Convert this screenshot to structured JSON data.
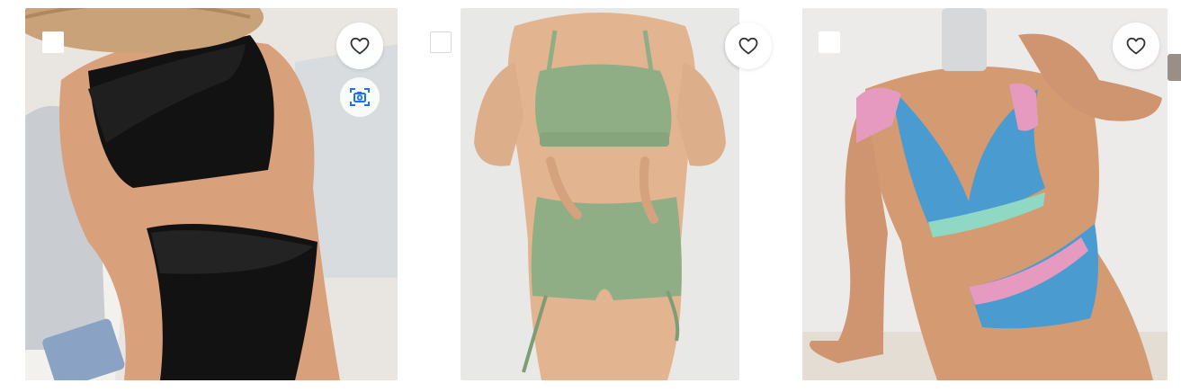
{
  "products": [
    {
      "colors": {
        "background": "#e9e6e1",
        "accent": "#111111"
      },
      "wishlist_icon": "heart-outline-icon",
      "visual_search_icon": "camera-scan-icon"
    },
    {
      "colors": {
        "background": "#e8e8e6",
        "accent": "#8fae85"
      },
      "wishlist_icon": "heart-outline-icon"
    },
    {
      "colors": {
        "background": "#ecebea",
        "accent": "#4a9bd0",
        "secondary": "#e79ac0",
        "trim": "#8fd8c4"
      },
      "wishlist_icon": "heart-outline-icon"
    }
  ],
  "colors": {
    "icon_stroke": "#333333",
    "scan_icon": "#1a73e8"
  }
}
